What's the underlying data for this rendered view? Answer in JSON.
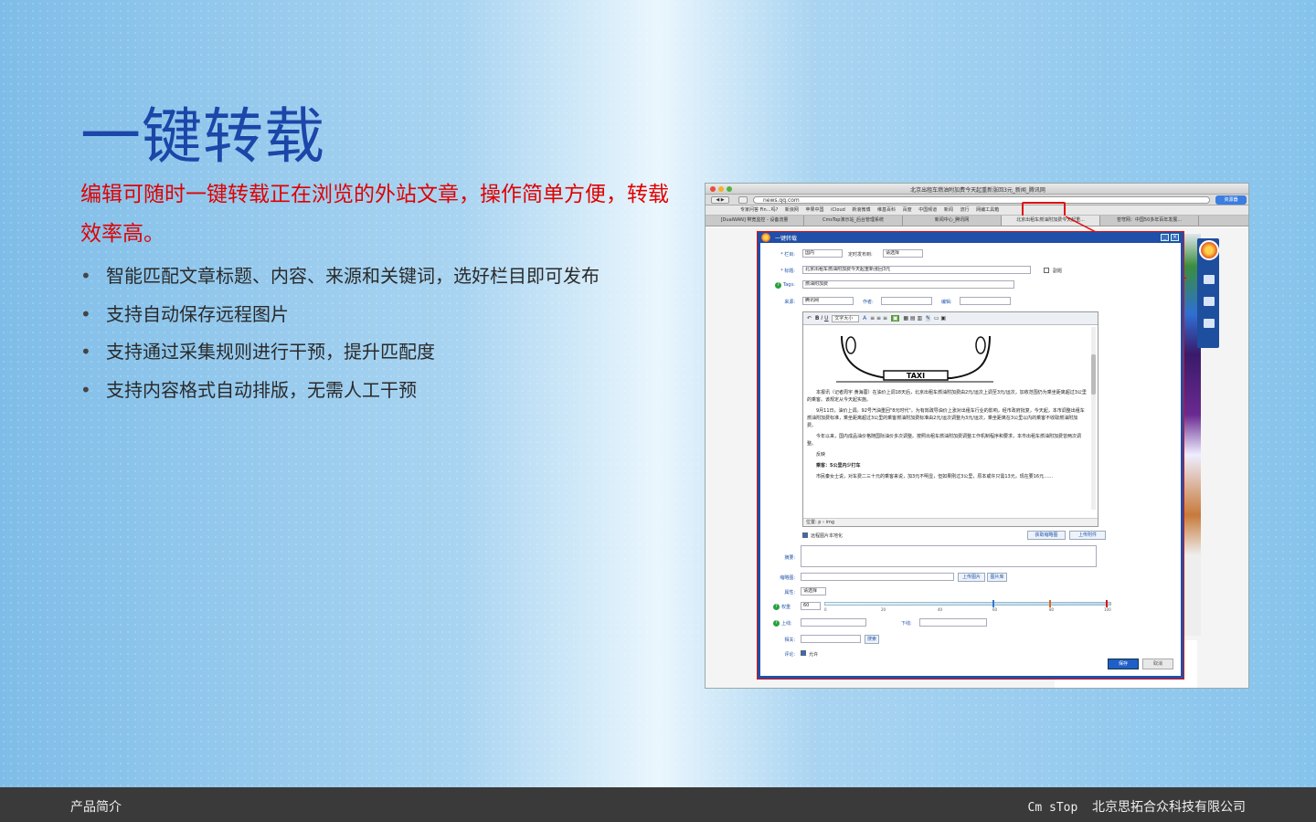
{
  "slide": {
    "title": "一键转载",
    "lead": "编辑可随时一键转载正在浏览的外站文章，操作简单方便，转载效率高。",
    "bullets": [
      "智能匹配文章标题、内容、来源和关键词，选好栏目即可发布",
      "支持自动保存远程图片",
      "支持通过采集规则进行干预，提升匹配度",
      "支持内容格式自动排版，无需人工干预"
    ],
    "bullet_glyph": "•"
  },
  "footer": {
    "left": "产品简介",
    "brand": "Cm sTop",
    "company": "北京思拓合众科技有限公司"
  },
  "screenshot": {
    "window_title": "北京出租车燃油附加费今天起重新涨回3元_新闻_腾讯网",
    "url": "news.qq.com",
    "reading_list": "资源器",
    "bookmarks": [
      "专家问答 Fin…吗?",
      "新浪网",
      "苹果中国",
      "iCloud",
      "新浪微博",
      "维基百科",
      "百度",
      "中国频道",
      "新闻",
      "流行",
      "网编工具箱"
    ],
    "highlighted_bookmark": "网编工具箱",
    "tabs": [
      "[DualWAN] 带宽监控 - 设备流量",
      "CmsTop演示站_后台管理系统",
      "新闻中心_腾讯网",
      "北京出租车燃油附加费今天起重...",
      "苍穹网：中国50多年百年发展..."
    ],
    "dialog": {
      "title": "一键转载",
      "fields": {
        "column_label": "* 栏目:",
        "column_value": "国内",
        "timed_label": "定时发布到:",
        "timed_value": "请选择",
        "title_label": "* 标题:",
        "title_value": "北京出租车燃油附加费今天起重新涨回3元",
        "subtitle_label": "副题",
        "tags_label": "Tags:",
        "tags_value": "燃油附加费",
        "source_label": "来源:",
        "source_value": "腾讯网",
        "author_label": "作者:",
        "editor_label": "编辑:"
      },
      "editor": {
        "toolbar_font": "文字大小",
        "status": "位置: p › img",
        "paragraphs": [
          "本报讯（记者周宇 黄海蓉）在油价上调18天后，北京出租车燃油附加费由2元/运次上调至3元/运次，加收范围仍为乘坐距离超过3公里的乘客。该规定从今天起实施。",
          "9月11日，油价上调。92号汽油重回\"8元时代\"。为有效疏导油价上涨对出租车行业的影响，经市政府批复，今天起，本市调整出租车燃油附加费标准，乘坐距离超过3公里的乘客燃油附加费标准由2元/运次调整为3元/运次，乘坐距离在3公里以内的乘客不收取燃油附加费。",
          "今年以来，国内成品油价格随国际油价多次调整。按照出租车燃油附加费调整工作机制程序和要求，本市出租车燃油附加费曾两次调整。",
          "反映",
          "乘客：5公里内少打车",
          "市民秦女士说，对车费二三十元的乘客来说，加3元不明显，但如果刚过3公里，原本或许只需13元，现在要16元……"
        ],
        "taxi_sign": "TAXI"
      },
      "save_remote_images": "远程图片本地化",
      "auto_thumb_btn": "获取缩略图",
      "upload_attach_btn": "上传附件",
      "summary_label": "摘要:",
      "thumb_label": "缩略图:",
      "upload_image_btn": "上传图片",
      "image_lib_btn": "图片库",
      "attr_label": "属性:",
      "attr_value": "请选择",
      "weight_label": "权重",
      "weight_value": "60",
      "weight_scale": [
        "0",
        "20",
        "40",
        "60",
        "80",
        "100"
      ],
      "online_label": "上线:",
      "offline_label": "下线:",
      "related_label": "相关:",
      "search_btn": "搜索",
      "comment_label": "评论:",
      "comment_value": "允许",
      "save_btn": "保存",
      "cancel_btn": "取消"
    }
  }
}
